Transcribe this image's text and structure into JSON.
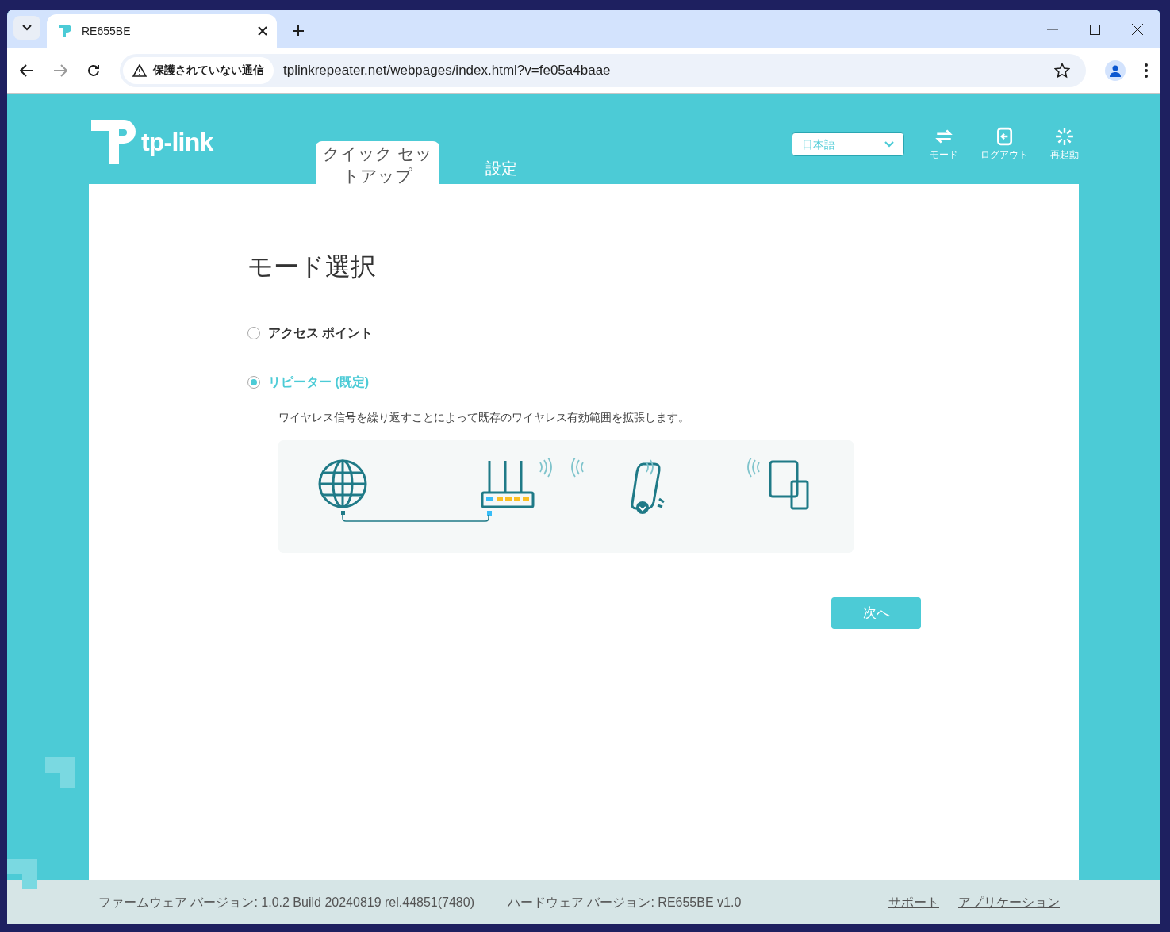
{
  "browser": {
    "tab_title": "RE655BE",
    "security_label": "保護されていない通信",
    "url": "tplinkrepeater.net/webpages/index.html?v=fe05a4baae"
  },
  "header": {
    "logo": "tp-link",
    "nav_tabs": [
      {
        "label": "クイック セットアップ",
        "selected": true
      },
      {
        "label": "設定",
        "selected": false
      }
    ],
    "language": "日本語",
    "actions": [
      {
        "kind": "mode",
        "label": "モード"
      },
      {
        "kind": "logout",
        "label": "ログアウト"
      },
      {
        "kind": "reboot",
        "label": "再起動"
      }
    ]
  },
  "page": {
    "title": "モード選択",
    "options": [
      {
        "label": "アクセス ポイント",
        "selected": false
      },
      {
        "label": "リピーター (既定)",
        "selected": true,
        "description": "ワイヤレス信号を繰り返すことによって既存のワイヤレス有効範囲を拡張します。"
      }
    ],
    "next_button": "次へ"
  },
  "footer": {
    "firmware": "ファームウェア バージョン: 1.0.2 Build 20240819 rel.44851(7480)",
    "hardware": "ハードウェア バージョン: RE655BE v1.0",
    "links": [
      "サポート",
      "アプリケーション"
    ]
  }
}
